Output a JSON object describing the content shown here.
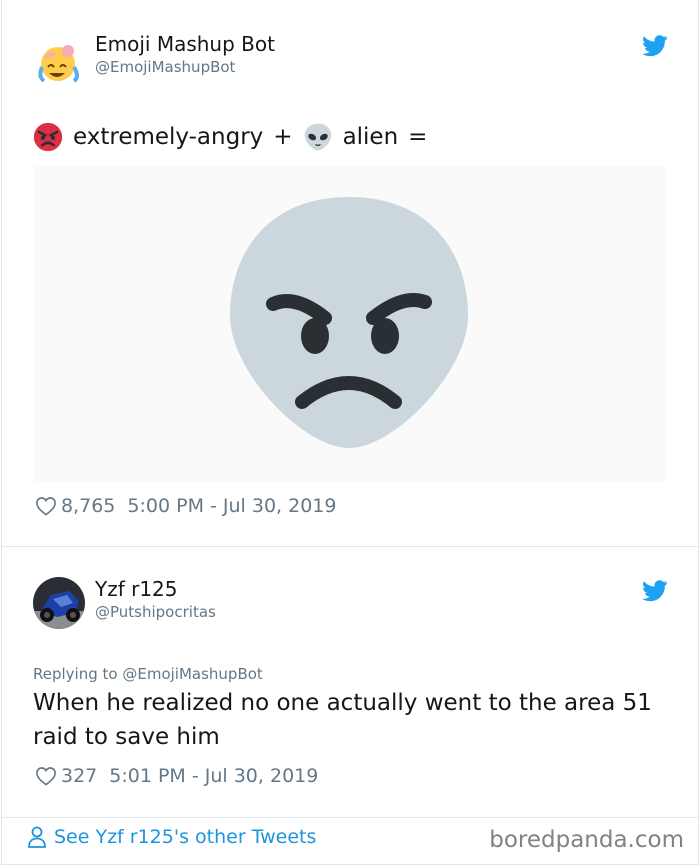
{
  "tweet": {
    "author_name": "Emoji Mashup Bot",
    "author_handle": "@EmojiMashupBot",
    "emoji_1_name": "extremely-angry",
    "plus": "+",
    "emoji_2_name": "alien",
    "equals": "=",
    "likes": "8,765",
    "timestamp": "5:00 PM - Jul 30, 2019"
  },
  "reply": {
    "author_name": "Yzf r125",
    "author_handle": "@Putshipocritas",
    "replying_to_label": "Replying to",
    "replying_to_handle": "@EmojiMashupBot",
    "text": "When he realized no one actually went to the area 51 raid to save him",
    "likes": "327",
    "timestamp": "5:01 PM - Jul 30, 2019"
  },
  "footer": {
    "see_more": "See Yzf r125's other Tweets",
    "watermark": "boredpanda.com"
  },
  "colors": {
    "twitter_blue": "#1da1f2",
    "link_blue": "#1b95e0",
    "secondary_text": "#657786",
    "alien_gray": "#ccd6dd",
    "angry_red": "#da2f47"
  },
  "icons": {
    "twitter_bird": "twitter-bird-icon",
    "heart": "heart-icon",
    "user": "user-icon"
  }
}
